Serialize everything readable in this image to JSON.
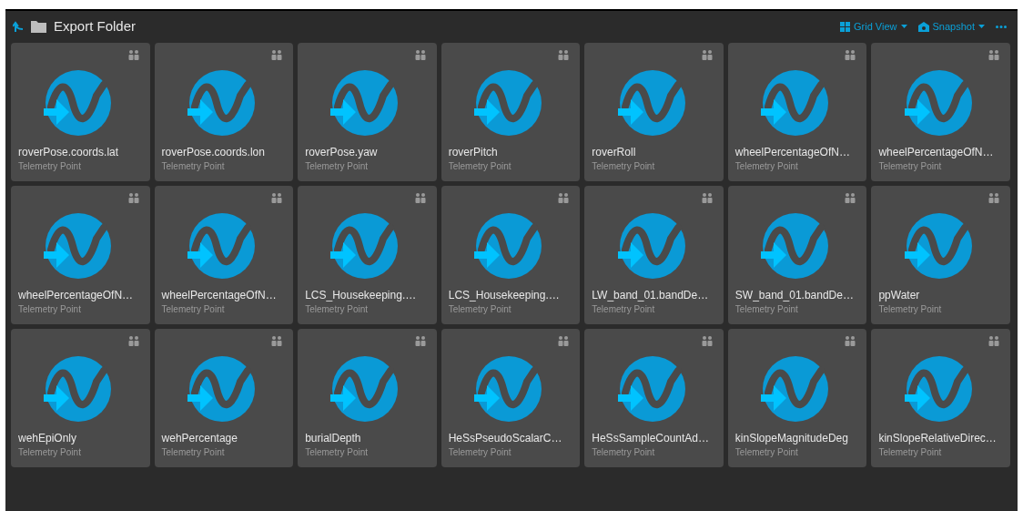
{
  "header": {
    "title": "Export Folder",
    "view_menu": "Grid View",
    "snapshot_menu": "Snapshot"
  },
  "items": [
    {
      "name": "roverPose.coords.lat",
      "type": "Telemetry Point"
    },
    {
      "name": "roverPose.coords.lon",
      "type": "Telemetry Point"
    },
    {
      "name": "roverPose.yaw",
      "type": "Telemetry Point"
    },
    {
      "name": "roverPitch",
      "type": "Telemetry Point"
    },
    {
      "name": "roverRoll",
      "type": "Telemetry Point"
    },
    {
      "name": "wheelPercentageOfN…",
      "type": "Telemetry Point"
    },
    {
      "name": "wheelPercentageOfN…",
      "type": "Telemetry Point"
    },
    {
      "name": "wheelPercentageOfN…",
      "type": "Telemetry Point"
    },
    {
      "name": "wheelPercentageOfN…",
      "type": "Telemetry Point"
    },
    {
      "name": "LCS_Housekeeping.…",
      "type": "Telemetry Point"
    },
    {
      "name": "LCS_Housekeeping.…",
      "type": "Telemetry Point"
    },
    {
      "name": "LW_band_01.bandDe…",
      "type": "Telemetry Point"
    },
    {
      "name": "SW_band_01.bandDe…",
      "type": "Telemetry Point"
    },
    {
      "name": "ppWater",
      "type": "Telemetry Point"
    },
    {
      "name": "wehEpiOnly",
      "type": "Telemetry Point"
    },
    {
      "name": "wehPercentage",
      "type": "Telemetry Point"
    },
    {
      "name": "burialDepth",
      "type": "Telemetry Point"
    },
    {
      "name": "HeSsPseudoScalarC…",
      "type": "Telemetry Point"
    },
    {
      "name": "HeSsSampleCountAd…",
      "type": "Telemetry Point"
    },
    {
      "name": "kinSlopeMagnitudeDeg",
      "type": "Telemetry Point"
    },
    {
      "name": "kinSlopeRelativeDirec…",
      "type": "Telemetry Point"
    }
  ]
}
